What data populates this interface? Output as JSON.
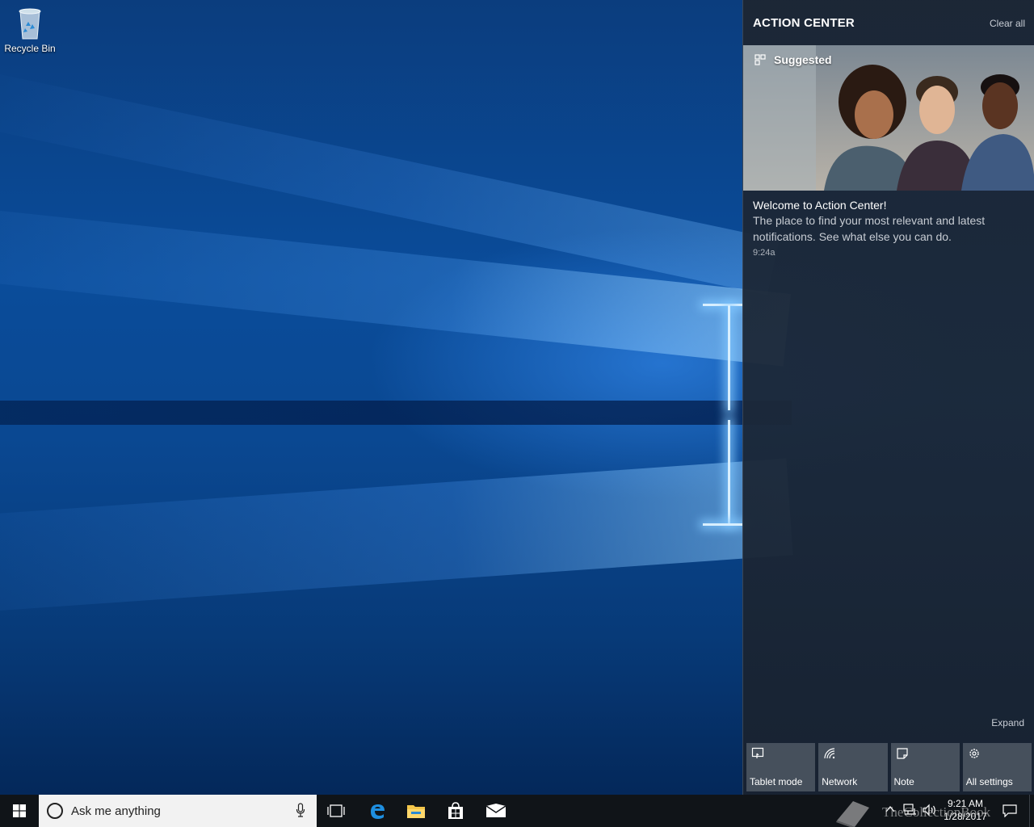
{
  "desktop": {
    "icons": [
      {
        "label": "Recycle Bin",
        "icon": "recycle-bin-icon"
      }
    ]
  },
  "action_center": {
    "title": "ACTION CENTER",
    "clear_all": "Clear all",
    "suggested_label": "Suggested",
    "notification": {
      "title": "Welcome to Action Center!",
      "body": "The place to find your most relevant and latest notifications. See what else you can do.",
      "time": "9:24a"
    },
    "expand": "Expand",
    "quick_actions": [
      {
        "label": "Tablet mode",
        "icon": "tablet-mode-icon"
      },
      {
        "label": "Network",
        "icon": "network-icon"
      },
      {
        "label": "Note",
        "icon": "note-icon"
      },
      {
        "label": "All settings",
        "icon": "gear-icon"
      }
    ]
  },
  "taskbar": {
    "search_placeholder": "Ask me anything",
    "apps": [
      "task-view-icon",
      "edge-icon",
      "file-explorer-icon",
      "store-icon",
      "mail-icon"
    ],
    "clock": {
      "time": "9:21 AM",
      "date": "1/28/2017"
    },
    "watermark": "TheCollectionBook"
  },
  "colors": {
    "accent": "#0078d7",
    "taskbar": "#101418",
    "action_center_bg": "#1c2634"
  }
}
